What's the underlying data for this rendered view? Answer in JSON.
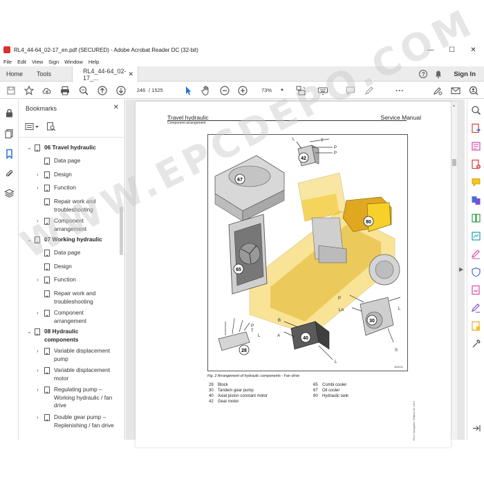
{
  "window": {
    "title": "RL4_44-64_02-17_en.pdf (SECURED) - Adobe Acrobat Reader DC (32-bit)",
    "controls": [
      "—",
      "☐",
      "✕"
    ]
  },
  "menu": [
    "File",
    "Edit",
    "View",
    "Sign",
    "Window",
    "Help"
  ],
  "tabs": {
    "home": "Home",
    "tools": "Tools",
    "document": "RL4_44-64_02-17_...",
    "close": "✕",
    "signin": "Sign In",
    "help": "?"
  },
  "toolbar": {
    "page_current": "246",
    "page_total": "/  1525",
    "zoom": "73%",
    "more": "···"
  },
  "bookmarks": {
    "header": "Bookmarks",
    "close": "✕",
    "items": [
      {
        "label": "06 Travel hydraulic",
        "bold": true,
        "expanded": true
      },
      {
        "label": "Data page"
      },
      {
        "label": "Design",
        "chevron": true
      },
      {
        "label": "Function",
        "chevron": true
      },
      {
        "label": "Repair work and troubleshooting"
      },
      {
        "label": "Component arrangement",
        "chevron": true
      },
      {
        "label": "07 Working hydraulic",
        "bold": true,
        "expanded": true
      },
      {
        "label": "Data page"
      },
      {
        "label": "Design"
      },
      {
        "label": "Function",
        "chevron": true
      },
      {
        "label": "Repair work and troubleshooting"
      },
      {
        "label": "Component arrangement",
        "chevron": true
      },
      {
        "label": "08 Hydraulic components",
        "bold": true,
        "expanded": true
      },
      {
        "label": "Variable displacement pump",
        "chevron": true
      },
      {
        "label": "Variable displacement motor",
        "chevron": true
      },
      {
        "label": "Regulating pump – Working hydraulic / fan drive",
        "chevron": true
      },
      {
        "label": "Double gear pump – Replenishing / fan drive",
        "chevron": true
      }
    ]
  },
  "document": {
    "header_left": "Travel hydraulic",
    "header_sub": "Component arrangement",
    "header_right": "Service Manual",
    "figure_number": "405011",
    "caption": "Fig. 2  Arrangement of hydraulic components - Fan drive",
    "legend_col1": [
      {
        "num": "28",
        "text": "Block"
      },
      {
        "num": "30",
        "text": "Tandem gear pump"
      },
      {
        "num": "40",
        "text": "Axial piston constant motor"
      },
      {
        "num": "42",
        "text": "Gear motor"
      }
    ],
    "legend_col2": [
      {
        "num": "65",
        "text": "Combi cooler"
      },
      {
        "num": "67",
        "text": "Oil cooler"
      },
      {
        "num": "80",
        "text": "Hydraulic tank"
      }
    ],
    "side_text": "RL4 / Ausgabe / Edition 02.2017",
    "watermark": "WWW.EPCDEPO.COM",
    "callouts": {
      "c67": "67",
      "c42": "42",
      "c80": "80",
      "c65": "65",
      "c30": "30",
      "c40": "40",
      "c28": "28",
      "L": "L",
      "T": "T",
      "P": "P",
      "B": "B",
      "A": "A",
      "S": "S",
      "LA": "LA"
    }
  },
  "colors": {
    "accent": "#2b6fd6",
    "machine_yellow": "#f2c21a",
    "pdf_red": "#d9302c"
  }
}
